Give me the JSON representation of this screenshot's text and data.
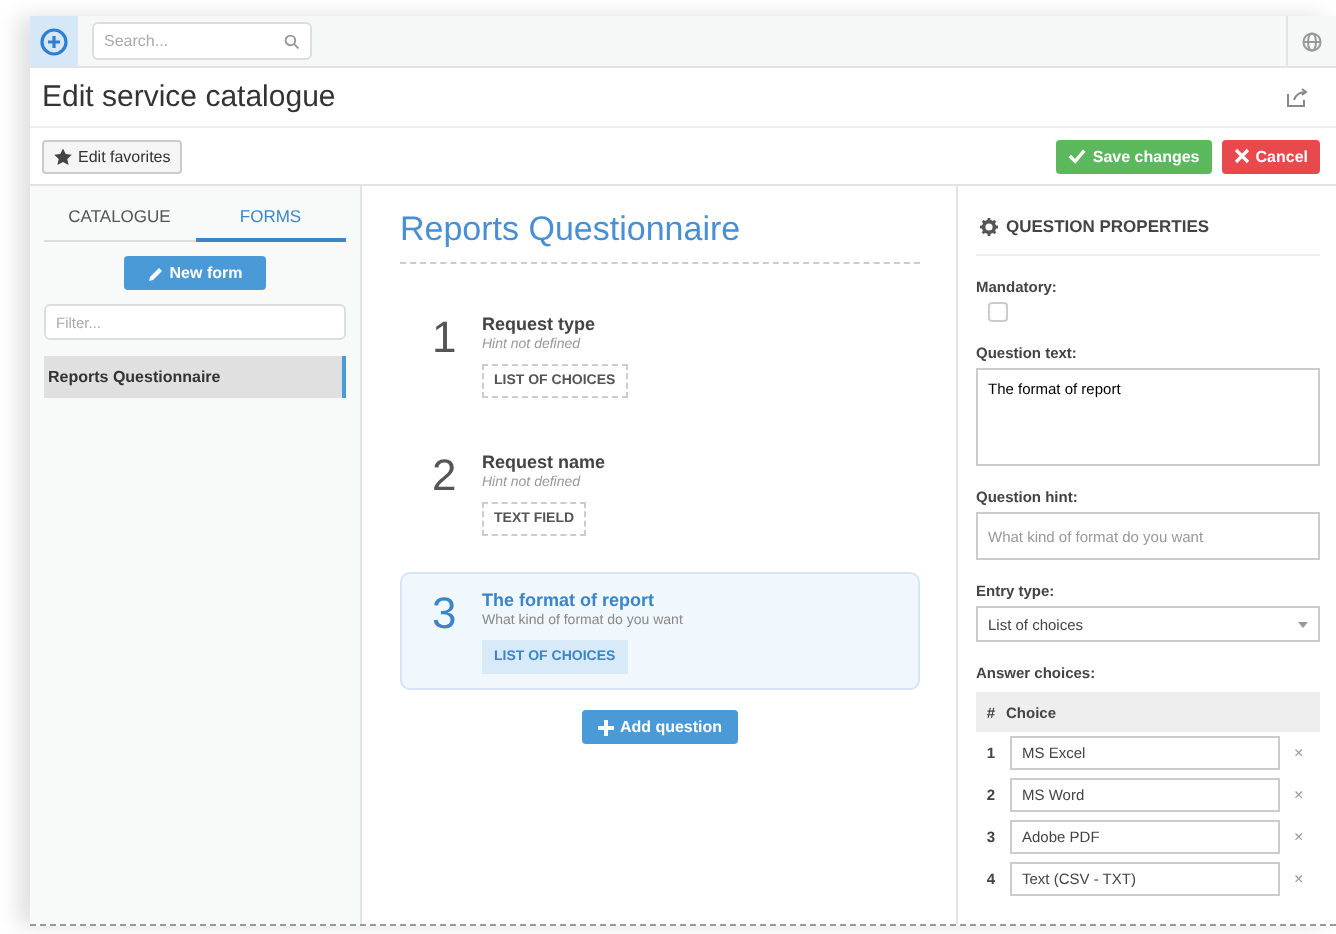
{
  "topbar": {
    "search_placeholder": "Search..."
  },
  "page_title": "Edit service catalogue",
  "toolbar": {
    "favorites": "Edit favorites",
    "save": "Save changes",
    "cancel": "Cancel"
  },
  "sidebar": {
    "tabs": [
      {
        "label": "CATALOGUE",
        "selected": false
      },
      {
        "label": "FORMS",
        "selected": true
      }
    ],
    "new_form": "New form",
    "filter_placeholder": "Filter...",
    "items": [
      {
        "label": "Reports Questionnaire",
        "selected": true
      }
    ]
  },
  "form": {
    "title": "Reports Questionnaire",
    "questions": [
      {
        "number": "1",
        "title": "Request type",
        "hint": "Hint not defined",
        "hint_defined": false,
        "type": "LIST OF CHOICES",
        "selected": false
      },
      {
        "number": "2",
        "title": "Request name",
        "hint": "Hint not defined",
        "hint_defined": false,
        "type": "TEXT FIELD",
        "selected": false
      },
      {
        "number": "3",
        "title": "The format of report",
        "hint": "What kind of format do you want",
        "hint_defined": true,
        "type": "LIST OF CHOICES",
        "selected": true
      }
    ],
    "add_question": "Add question"
  },
  "properties": {
    "heading": "QUESTION PROPERTIES",
    "mandatory_label": "Mandatory:",
    "mandatory": false,
    "text_label": "Question text:",
    "text": "The format of report",
    "hint_label": "Question hint:",
    "hint_placeholder": "What kind of format do you want",
    "entry_label": "Entry type:",
    "entry": "List of choices",
    "choices_label": "Answer choices:",
    "columns": [
      "#",
      "Choice"
    ],
    "choices": [
      {
        "number": "1",
        "value": "MS Excel",
        "remove": "×"
      },
      {
        "number": "2",
        "value": "MS Word",
        "remove": "×"
      },
      {
        "number": "3",
        "value": "Adobe PDF",
        "remove": "×"
      },
      {
        "number": "4",
        "value": "Text (CSV - TXT)",
        "remove": "×"
      }
    ]
  }
}
